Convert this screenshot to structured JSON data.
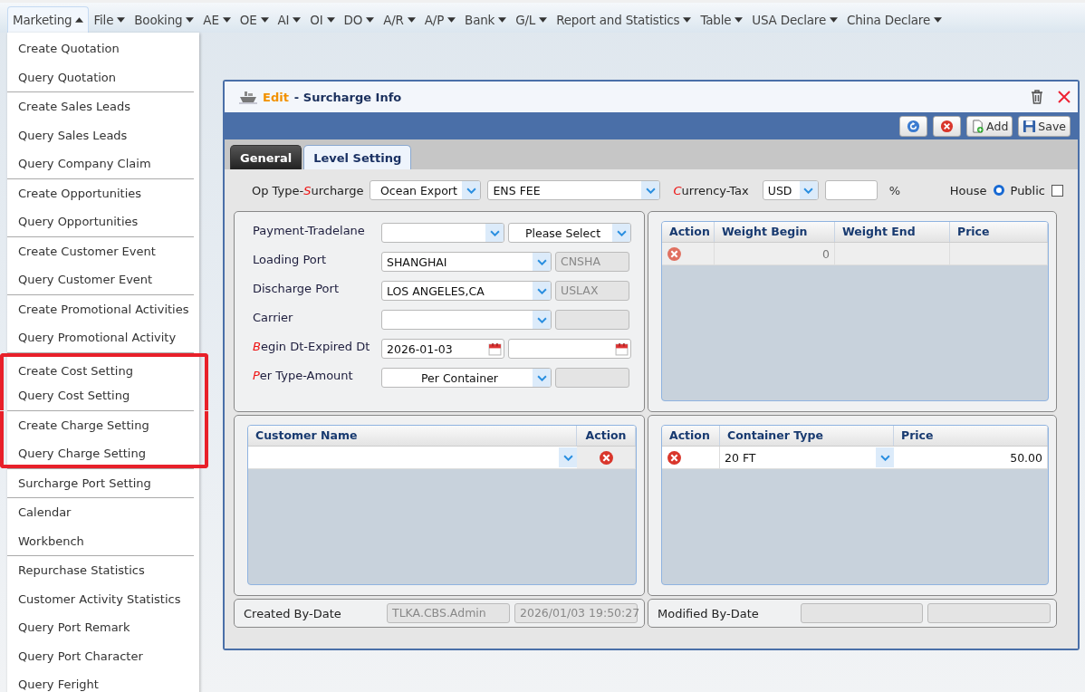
{
  "menubar": [
    {
      "label": "Marketing",
      "open": true
    },
    {
      "label": "File",
      "open": false
    },
    {
      "label": "Booking",
      "open": false
    },
    {
      "label": "AE",
      "open": false
    },
    {
      "label": "OE",
      "open": false
    },
    {
      "label": "AI",
      "open": false
    },
    {
      "label": "OI",
      "open": false
    },
    {
      "label": "DO",
      "open": false
    },
    {
      "label": "A/R",
      "open": false
    },
    {
      "label": "A/P",
      "open": false
    },
    {
      "label": "Bank",
      "open": false
    },
    {
      "label": "G/L",
      "open": false
    },
    {
      "label": "Report and Statistics",
      "open": false
    },
    {
      "label": "Table",
      "open": false
    },
    {
      "label": "USA Declare",
      "open": false
    },
    {
      "label": "China Declare",
      "open": false
    }
  ],
  "menu": {
    "groups": [
      {
        "items": [
          {
            "label": "Create Quotation",
            "highlighted": false
          },
          {
            "label": "Query Quotation",
            "highlighted": false
          }
        ]
      },
      {
        "items": [
          {
            "label": "Create Sales Leads",
            "highlighted": false
          },
          {
            "label": "Query Sales Leads",
            "highlighted": false
          },
          {
            "label": "Query Company Claim",
            "highlighted": false
          }
        ]
      },
      {
        "items": [
          {
            "label": "Create Opportunities",
            "highlighted": false
          },
          {
            "label": "Query Opportunities",
            "highlighted": false
          }
        ]
      },
      {
        "items": [
          {
            "label": "Create Customer Event",
            "highlighted": false
          },
          {
            "label": "Query Customer Event",
            "highlighted": false
          }
        ]
      },
      {
        "items": [
          {
            "label": "Create Promotional Activities",
            "highlighted": false
          },
          {
            "label": "Query Promotional Activity",
            "highlighted": false
          }
        ]
      },
      {
        "items": [
          {
            "label": "Create Cost Setting",
            "highlighted": true
          },
          {
            "label": "Query Cost Setting",
            "highlighted": true
          }
        ]
      },
      {
        "items": [
          {
            "label": "Create Charge Setting",
            "highlighted": true
          },
          {
            "label": "Query Charge Setting",
            "highlighted": true
          }
        ]
      },
      {
        "items": [
          {
            "label": "Surcharge Port Setting",
            "highlighted": false
          }
        ]
      },
      {
        "items": [
          {
            "label": "Calendar",
            "highlighted": false
          },
          {
            "label": "Workbench",
            "highlighted": false
          }
        ]
      },
      {
        "items": [
          {
            "label": "Repurchase Statistics",
            "highlighted": false
          },
          {
            "label": "Customer Activity Statistics",
            "highlighted": false
          },
          {
            "label": "Query Port Remark",
            "highlighted": false
          },
          {
            "label": "Query Port Character",
            "highlighted": false
          },
          {
            "label": "Query Feright",
            "highlighted": false
          }
        ]
      }
    ]
  },
  "window": {
    "mode": "Edit",
    "title": "- Surcharge Info",
    "toolbar": [
      {
        "kind": "refresh"
      },
      {
        "kind": "cancel"
      },
      {
        "kind": "add",
        "label": "Add"
      },
      {
        "kind": "save",
        "label": "Save"
      }
    ],
    "tabs": [
      {
        "label": "General",
        "selected": true
      },
      {
        "label": "Level Setting",
        "selected": false
      }
    ],
    "top_row": {
      "label": [
        {
          "text": "Op Type-",
          "required": false
        },
        {
          "text": "Surcharge",
          "required": true
        }
      ],
      "op_type": {
        "value": "Ocean Export"
      },
      "surcharge": {
        "value": "ENS FEE"
      },
      "label2": [
        {
          "text": "Currency-",
          "required": true
        },
        {
          "text": "Tax",
          "required": false
        }
      ],
      "currency": {
        "value": "USD"
      },
      "unit": "%",
      "house": {
        "label": "House",
        "selected": true
      },
      "public": {
        "label": "Public",
        "checked": false
      }
    },
    "form_rows": [
      {
        "label": [
          {
            "text": "Payment-",
            "required": false
          },
          {
            "text": "Tradelane",
            "required": false
          }
        ],
        "fields": [
          {
            "kind": "select"
          },
          {
            "kind": "select",
            "value": "Please Select"
          }
        ]
      },
      {
        "label": [
          {
            "text": "Loading Port",
            "required": false
          }
        ],
        "fields": [
          {
            "kind": "select-wide",
            "value": "SHANGHAI"
          },
          {
            "kind": "code",
            "value": "CNSHA"
          }
        ]
      },
      {
        "label": [
          {
            "text": "Discharge Port",
            "required": false
          }
        ],
        "fields": [
          {
            "kind": "select-wide",
            "value": "LOS ANGELES,CA"
          },
          {
            "kind": "code",
            "value": "USLAX"
          }
        ]
      },
      {
        "label": [
          {
            "text": "Carrier",
            "required": false
          }
        ],
        "fields": [
          {
            "kind": "select-wide"
          },
          {
            "kind": "code"
          }
        ]
      },
      {
        "label": [
          {
            "text": "Begin Dt-",
            "required": true
          },
          {
            "text": "Expired Dt",
            "required": false
          }
        ],
        "fields": [
          {
            "kind": "date",
            "value": "2026-01-03"
          },
          {
            "kind": "date"
          }
        ]
      },
      {
        "label": [
          {
            "text": "Per Type-",
            "required": true
          },
          {
            "text": "Amount",
            "required": false
          }
        ],
        "fields": [
          {
            "kind": "select-wide",
            "value": "Per Container"
          },
          {
            "kind": "code"
          }
        ]
      }
    ],
    "weight_table": {
      "columns": [
        "Action",
        "Weight Begin",
        "Weight End",
        "Price"
      ],
      "rows": [
        {
          "weight_begin": "0"
        }
      ]
    },
    "customer_table": {
      "columns": [
        "Customer Name",
        "Action"
      ],
      "rows": [
        {}
      ]
    },
    "container_table": {
      "columns": [
        "Action",
        "Container Type",
        "Price"
      ],
      "rows": [
        {
          "container_type": "20 FT",
          "price": "50.00"
        }
      ]
    },
    "created": {
      "label": "Created By-Date",
      "by": "TLKA.CBS.Admin",
      "date": "2026/01/03 19:50:27"
    },
    "modified": {
      "label": "Modified By-Date"
    }
  }
}
